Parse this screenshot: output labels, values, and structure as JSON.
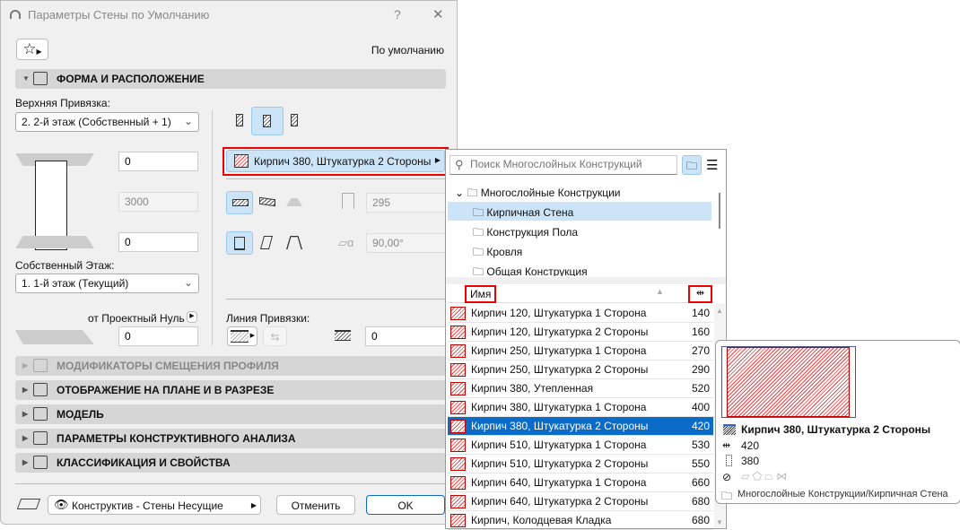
{
  "window": {
    "title": "Параметры Стены по Умолчанию",
    "help": "?",
    "close": "✕"
  },
  "favorites": {
    "icon": "star-icon",
    "default_label": "По умолчанию"
  },
  "sections": {
    "geometry": "ФОРМА И РАСПОЛОЖЕНИЕ",
    "profile_modifiers": "МОДИФИКАТОРЫ СМЕЩЕНИЯ ПРОФИЛЯ",
    "floor_plan": "ОТОБРАЖЕНИЕ НА ПЛАНЕ И В РАЗРЕЗЕ",
    "model": "МОДЕЛЬ",
    "structural": "ПАРАМЕТРЫ КОНСТРУКТИВНОГО АНАЛИЗА",
    "classification": "КЛАССИФИКАЦИЯ И СВОЙСТВА"
  },
  "geometry": {
    "top_link_label": "Верхняя Привязка:",
    "top_link_value": "2. 2-й этаж (Собственный + 1)",
    "top_offset": "0",
    "height": "3000",
    "bottom_offset": "0",
    "home_story_label": "Собственный Этаж:",
    "home_story_value": "1. 1-й этаж (Текущий)",
    "ref_label": "от Проектный Нуль",
    "ref_value": "0",
    "composite": "Кирпич 380, Штукатурка 2 Стороны",
    "thickness": "295",
    "angle": "90,00°",
    "ref_line_label": "Линия Привязки:",
    "ref_line_offset": "0"
  },
  "footer": {
    "layer": "Конструктив - Стены Несущие",
    "cancel": "Отменить",
    "ok": "OK"
  },
  "popup": {
    "search_placeholder": "Поиск Многослойных Конструкций",
    "tree": {
      "root": "Многослойные Конструкции",
      "folders": [
        "Кирпичная Стена",
        "Конструкция Пола",
        "Кровля",
        "Общая Конструкция"
      ]
    },
    "columns": {
      "name": "Имя",
      "thickness_icon": "thickness-icon"
    },
    "items": [
      {
        "name": "Кирпич 120, Штукатурка 1 Сторона",
        "value": "140"
      },
      {
        "name": "Кирпич 120, Штукатурка 2 Стороны",
        "value": "160"
      },
      {
        "name": "Кирпич 250, Штукатурка 1 Сторона",
        "value": "270"
      },
      {
        "name": "Кирпич 250, Штукатурка 2 Стороны",
        "value": "290"
      },
      {
        "name": "Кирпич 380, Утепленная",
        "value": "520"
      },
      {
        "name": "Кирпич 380, Штукатурка 1 Сторона",
        "value": "400"
      },
      {
        "name": "Кирпич 380, Штукатурка 2 Стороны",
        "value": "420"
      },
      {
        "name": "Кирпич 510, Штукатурка 1 Сторона",
        "value": "530"
      },
      {
        "name": "Кирпич 510, Штукатурка 2 Стороны",
        "value": "550"
      },
      {
        "name": "Кирпич 640, Штукатурка 1 Сторона",
        "value": "660"
      },
      {
        "name": "Кирпич 640, Штукатурка 2 Стороны",
        "value": "680"
      },
      {
        "name": "Кирпич, Колодцевая Кладка",
        "value": "680"
      }
    ],
    "selected_index": 6
  },
  "tooltip": {
    "name": "Кирпич 380, Штукатурка 2 Стороны",
    "total": "420",
    "core": "380",
    "path": "Многослойные Конструкции/Кирпичная Стена"
  },
  "colors": {
    "accent": "#0a6bc9",
    "highlight": "#cce4f7",
    "callout": "#e00000"
  }
}
